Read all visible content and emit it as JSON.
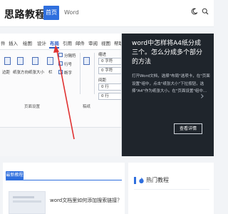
{
  "header": {
    "logo": "思路教程网",
    "nav": {
      "home": "首页",
      "word": "Word"
    }
  },
  "hero": {
    "menubar": [
      "件",
      "插入",
      "绘图",
      "设计",
      "布局",
      "引用",
      "邮件",
      "审阅",
      "视图",
      "帮助"
    ],
    "active_tab": "布局",
    "ribbon": {
      "labels": [
        "边距",
        "纸张方向",
        "纸张大小",
        "栏",
        "分隔符",
        "行号",
        "断字",
        "缩进",
        "间距"
      ],
      "indent_left": "0 字符",
      "indent_right": "0 字符",
      "spacing_before": "0 行",
      "spacing_after": "0 行",
      "group_page_setup": "页面设置",
      "group_draft": "稿纸"
    },
    "title": "word中怎样将A4纸分成三个。怎么分成多个部分的方法",
    "description": "打开Word文档，选择\"布局\"选项卡，在\"页面设置\"组中，点击\"纸张大小\"下拉按钮，选择\"A4\"作为纸张大小。在\"页面设置\"组中...",
    "read_button": "查看详情",
    "next_icon": "chevron-right-icon"
  },
  "latest": {
    "tag": "最新教程",
    "article_title": "word文档里如何添加搜索链接？"
  },
  "hot": {
    "title": "热门教程"
  },
  "colors": {
    "accent": "#2f6fde",
    "hero_bg": "#1f252c",
    "arrow": "#e03131"
  }
}
